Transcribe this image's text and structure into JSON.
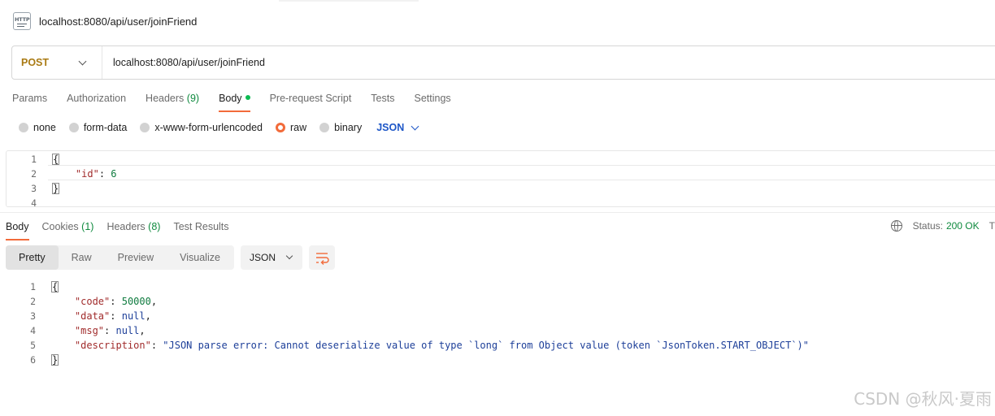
{
  "request": {
    "title": "localhost:8080/api/user/joinFriend",
    "method": "POST",
    "url": "localhost:8080/api/user/joinFriend"
  },
  "request_tabs": [
    {
      "label": "Params"
    },
    {
      "label": "Authorization"
    },
    {
      "label": "Headers",
      "count": "(9)"
    },
    {
      "label": "Body"
    },
    {
      "label": "Pre-request Script"
    },
    {
      "label": "Tests"
    },
    {
      "label": "Settings"
    }
  ],
  "body_modes": {
    "options": [
      "none",
      "form-data",
      "x-www-form-urlencoded",
      "raw",
      "binary"
    ],
    "selected": "raw",
    "type": "JSON"
  },
  "request_body": {
    "line_numbers": [
      "1",
      "2",
      "3",
      "4"
    ],
    "line1": "{",
    "line2_key": "\"id\"",
    "line2_sep": ": ",
    "line2_value": "6",
    "line3": "}"
  },
  "response_tabs": [
    {
      "label": "Body"
    },
    {
      "label": "Cookies",
      "count": "(1)"
    },
    {
      "label": "Headers",
      "count": "(8)"
    },
    {
      "label": "Test Results"
    }
  ],
  "status": {
    "label": "Status:",
    "value": "200 OK",
    "trailing": "T"
  },
  "view_modes": [
    "Pretty",
    "Raw",
    "Preview",
    "Visualize"
  ],
  "view_selected": "Pretty",
  "format": "JSON",
  "response_body": {
    "line_numbers": [
      "1",
      "2",
      "3",
      "4",
      "5",
      "6"
    ],
    "open": "{",
    "code_key": "\"code\"",
    "code_value": "50000",
    "data_key": "\"data\"",
    "data_value": "null",
    "msg_key": "\"msg\"",
    "msg_value": "null",
    "desc_key": "\"description\"",
    "desc_value": "\"JSON parse error: Cannot deserialize value of type `long` from Object value (token `JsonToken.START_OBJECT`)\"",
    "close": "}"
  },
  "watermark": "CSDN @秋风·夏雨",
  "colors": {
    "accent": "#f26b3a",
    "method": "#a97a13",
    "link": "#1d56c7",
    "success": "#0f8a3e"
  }
}
